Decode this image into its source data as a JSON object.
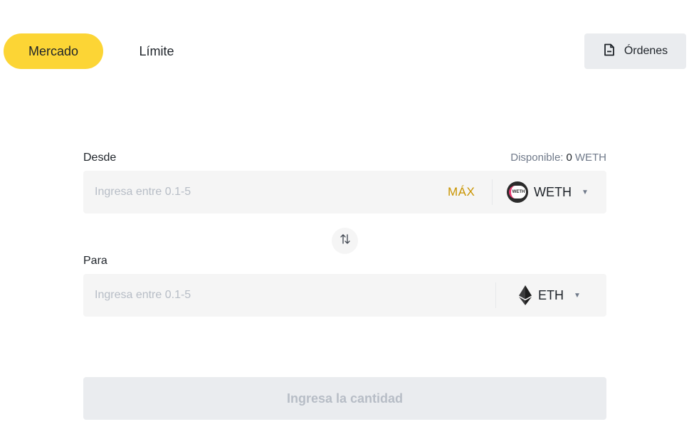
{
  "tabs": {
    "market_label": "Mercado",
    "limit_label": "Límite",
    "active": "market"
  },
  "orders": {
    "label": "Órdenes",
    "icon": "document-icon"
  },
  "from": {
    "label": "Desde",
    "available_prefix": "Disponible:",
    "available_value": "0",
    "available_unit": "WETH",
    "input_placeholder": "Ingresa entre 0.1-5",
    "input_value": "",
    "max_label": "MÁX",
    "token": "WETH",
    "token_icon": "weth-icon"
  },
  "swap": {
    "icon": "swap-arrows-icon"
  },
  "to": {
    "label": "Para",
    "input_placeholder": "Ingresa entre 0.1-5",
    "input_value": "",
    "token": "ETH",
    "token_icon": "eth-icon"
  },
  "submit": {
    "label": "Ingresa la cantidad",
    "disabled": true
  },
  "colors": {
    "accent": "#fcd535",
    "max_text": "#c99400",
    "field_bg": "#f5f5f5",
    "button_disabled_bg": "#eaecef",
    "muted_text": "#b7bdc6"
  }
}
